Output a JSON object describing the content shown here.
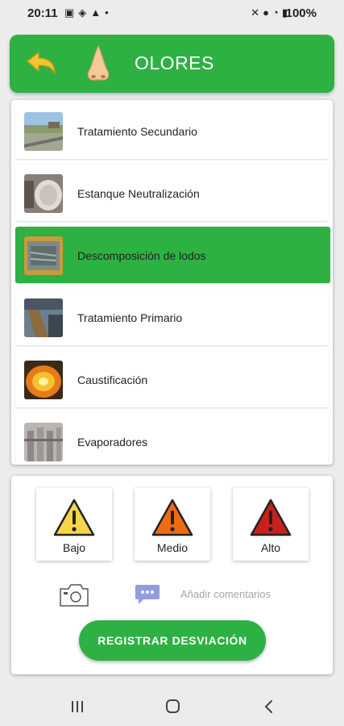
{
  "status_bar": {
    "time": "20:11",
    "battery": "100%",
    "left_icons": [
      "image-icon",
      "location-icon",
      "warning-icon",
      "dot-icon"
    ],
    "right_icons": [
      "mute-icon",
      "location-pin-icon",
      "wifi-icon",
      "signal-icon",
      "battery-icon"
    ]
  },
  "header": {
    "title": "OLORES",
    "back_icon": "back-arrow-icon",
    "nose_icon": "nose-icon",
    "color": "#2db143"
  },
  "items": [
    {
      "label": "Tratamiento Secundario",
      "selected": false
    },
    {
      "label": "Estanque Neutralización",
      "selected": false
    },
    {
      "label": "Descomposición de lodos",
      "selected": true
    },
    {
      "label": "Tratamiento Primario",
      "selected": false
    },
    {
      "label": "Caustificación",
      "selected": false
    },
    {
      "label": "Evaporadores",
      "selected": false
    }
  ],
  "risk": {
    "low": {
      "label": "Bajo",
      "color": "#f6d54a"
    },
    "medium": {
      "label": "Medio",
      "color": "#ef6a12"
    },
    "high": {
      "label": "Alto",
      "color": "#c9201e"
    }
  },
  "comment": {
    "placeholder": "Añadir comentarios"
  },
  "register_button": "REGISTRAR DESVIACIÓN",
  "accent_color": "#2db143"
}
